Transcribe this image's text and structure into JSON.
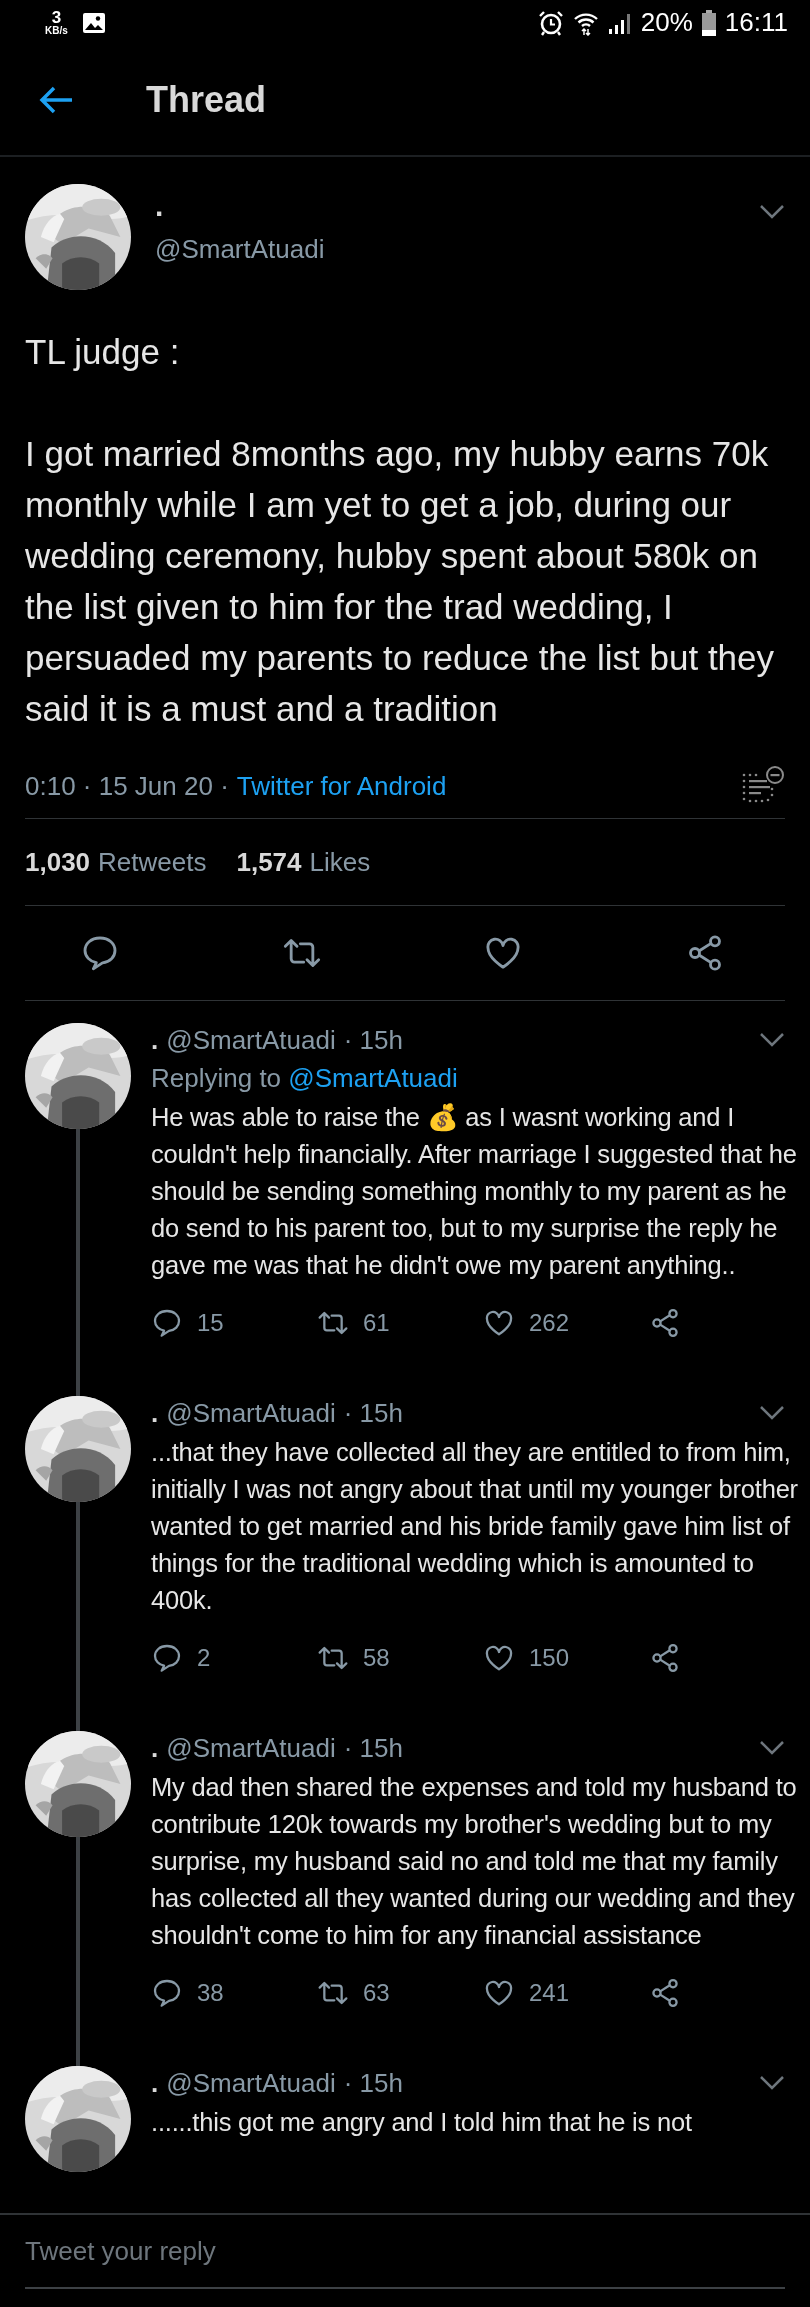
{
  "status_bar": {
    "net_speed": "3",
    "net_unit": "KB/s",
    "battery": "20%",
    "time": "16:11"
  },
  "header": {
    "title": "Thread"
  },
  "main_tweet": {
    "name": ".",
    "handle": "@SmartAtuadi",
    "paragraphs": [
      "TL judge :",
      "I got married 8months ago, my hubby earns 70k monthly while I am yet to get a job, during our wedding ceremony, hubby spent about 580k on the list given to him for the trad wedding, I persuaded my parents to reduce the list but they said it is a must and a tradition"
    ],
    "meta": "0:10 · 15 Jun 20 ·",
    "source": "Twitter for Android",
    "retweets": "1,030",
    "retweets_label": "Retweets",
    "likes": "1,574",
    "likes_label": "Likes"
  },
  "replies": [
    {
      "name": ".",
      "handle": "@SmartAtuadi",
      "age": "· 15h",
      "replying_to_label": "Replying to",
      "replying_to": "@SmartAtuadi",
      "text": "He was able to raise the 💰 as I wasnt working and I couldn't help financially. After marriage I suggested that he should be sending something monthly to my parent as he do send to his parent too, but to my surprise the reply he gave me was that he didn't owe my parent anything..",
      "replies": "15",
      "retweets": "61",
      "likes": "262"
    },
    {
      "name": ".",
      "handle": "@SmartAtuadi",
      "age": "· 15h",
      "text": "...that they have collected all they are entitled to from him, initially I was not angry about that until my younger brother wanted to get married and his bride family gave him list of things for the traditional wedding which is amounted to 400k.",
      "replies": "2",
      "retweets": "58",
      "likes": "150"
    },
    {
      "name": ".",
      "handle": "@SmartAtuadi",
      "age": "· 15h",
      "text": "My dad then shared the expenses and told my husband to contribute 120k towards my brother's wedding but to my surprise, my husband said no and told me that my family has collected all they wanted during our wedding and they shouldn't come to him for any financial assistance",
      "replies": "38",
      "retweets": "63",
      "likes": "241"
    },
    {
      "name": ".",
      "handle": "@SmartAtuadi",
      "age": "· 15h",
      "text": "......this got me angry and I told him that he is not"
    }
  ],
  "reply_box": {
    "placeholder": "Tweet your reply"
  }
}
